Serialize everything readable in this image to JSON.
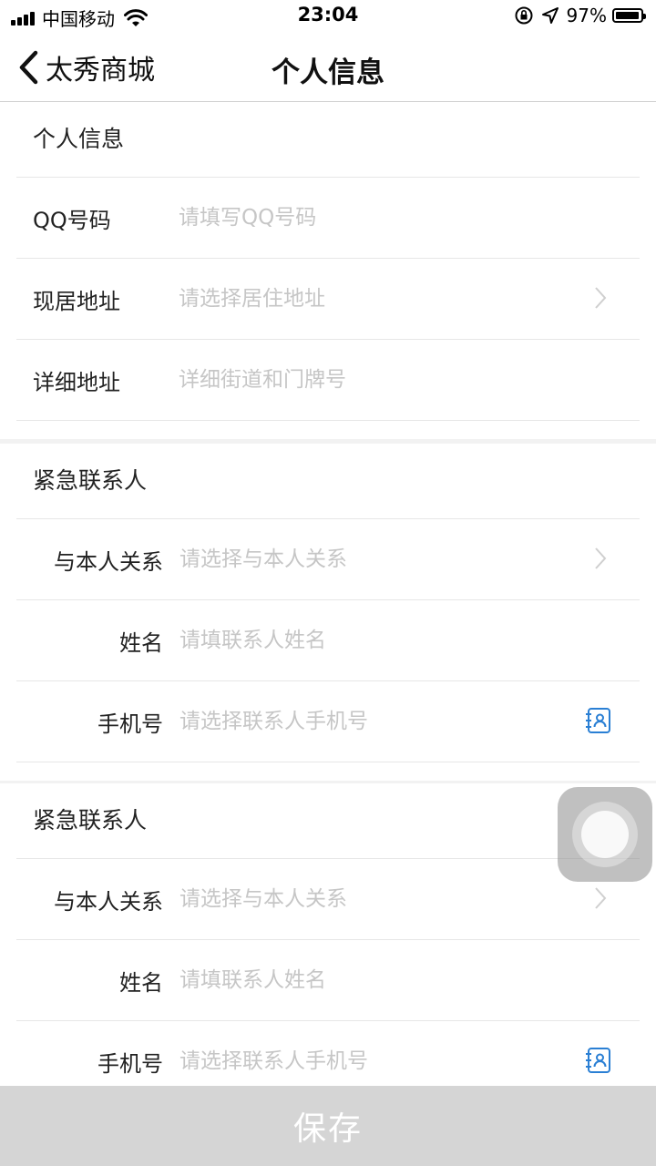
{
  "status_bar": {
    "carrier": "中国移动",
    "time": "23:04",
    "battery": "97%",
    "battery_level": 0.97
  },
  "nav": {
    "back_label": "太秀商城",
    "title": "个人信息"
  },
  "personal": {
    "header": "个人信息",
    "qq": {
      "label": "QQ号码",
      "placeholder": "请填写QQ号码"
    },
    "address": {
      "label": "现居地址",
      "placeholder": "请选择居住地址"
    },
    "detail": {
      "label": "详细地址",
      "placeholder": "详细街道和门牌号"
    }
  },
  "contact1": {
    "header": "紧急联系人",
    "relation": {
      "label": "与本人关系",
      "placeholder": "请选择与本人关系"
    },
    "name": {
      "label": "姓名",
      "placeholder": "请填联系人姓名"
    },
    "phone": {
      "label": "手机号",
      "placeholder": "请选择联系人手机号"
    }
  },
  "contact2": {
    "header": "紧急联系人",
    "relation": {
      "label": "与本人关系",
      "placeholder": "请选择与本人关系"
    },
    "name": {
      "label": "姓名",
      "placeholder": "请填联系人姓名"
    },
    "phone": {
      "label": "手机号",
      "placeholder": "请选择联系人手机号"
    }
  },
  "save_label": "保存",
  "colors": {
    "accent": "#2a7fd4",
    "placeholder": "#c6c6c6",
    "save_bg": "#d5d5d5"
  }
}
